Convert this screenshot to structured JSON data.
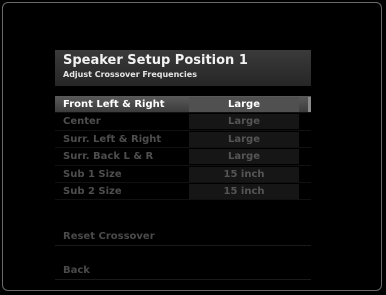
{
  "screen": {
    "title": "Speaker Setup Position 1",
    "subtitle": "Adjust Crossover Frequencies"
  },
  "settings": [
    {
      "label": "Front Left & Right",
      "value": "Large",
      "selected": true
    },
    {
      "label": "Center",
      "value": "Large",
      "selected": false
    },
    {
      "label": "Surr. Left & Right",
      "value": "Large",
      "selected": false
    },
    {
      "label": "Surr. Back L & R",
      "value": "Large",
      "selected": false
    },
    {
      "label": "Sub 1 Size",
      "value": "15 inch",
      "selected": false
    },
    {
      "label": "Sub 2 Size",
      "value": "15 inch",
      "selected": false
    }
  ],
  "actions": {
    "reset_label": "Reset Crossover",
    "back_label": "Back"
  },
  "colors": {
    "background": "#000000",
    "selected_row": "#505050",
    "selected_text": "#ffffff",
    "dimmed_text": "#4e4e4e"
  }
}
